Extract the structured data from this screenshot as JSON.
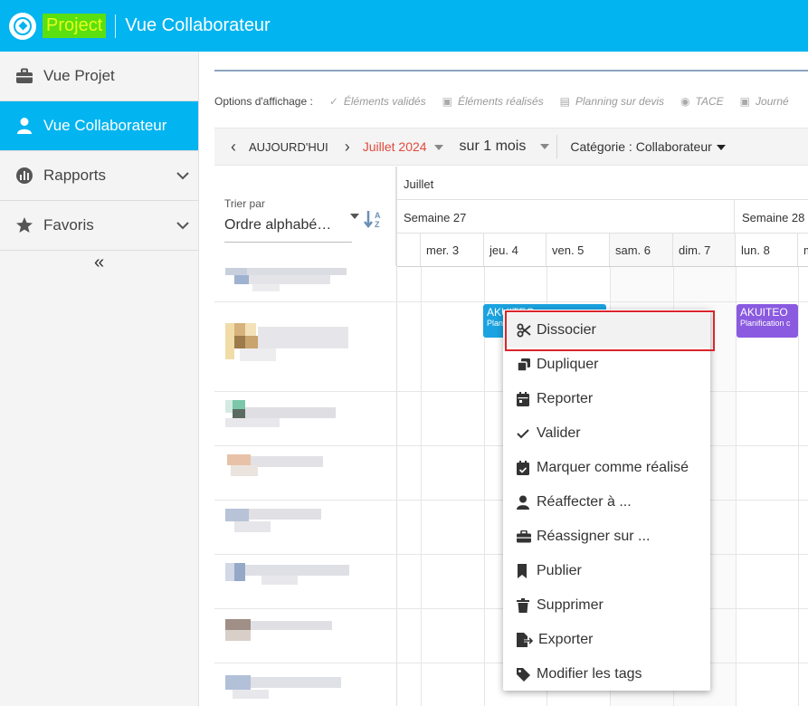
{
  "app": {
    "name": "Project",
    "view_title": "Vue Collaborateur"
  },
  "sidebar": {
    "items": [
      {
        "label": "Vue Projet",
        "icon": "briefcase-icon",
        "active": false
      },
      {
        "label": "Vue Collaborateur",
        "icon": "user-icon",
        "active": true
      },
      {
        "label": "Rapports",
        "icon": "chart-icon",
        "active": false
      },
      {
        "label": "Favoris",
        "icon": "star-icon",
        "active": false
      }
    ],
    "collapse_label": "«"
  },
  "options": {
    "label": "Options d'affichage :",
    "items": [
      "Éléments validés",
      "Éléments réalisés",
      "Planning sur devis",
      "TACE",
      "Journé"
    ]
  },
  "toolbar": {
    "today": "AUJOURD'HUI",
    "month": "Juillet 2024",
    "range": "sur 1 mois",
    "category": "Catégorie : Collaborateur"
  },
  "sort": {
    "label": "Trier par",
    "value": "Ordre alphabé…"
  },
  "calendar": {
    "month": "Juillet",
    "weeks": [
      "Semaine 27",
      "Semaine 28"
    ],
    "days": [
      "mer. 3",
      "jeu. 4",
      "ven. 5",
      "sam. 6",
      "dim. 7",
      "lun. 8",
      "m"
    ]
  },
  "events": [
    {
      "title": "AKUITEO",
      "subtitle": "Plani",
      "color": "#1aa3e0"
    },
    {
      "title": "AKUITEO",
      "subtitle": "Planification c",
      "color": "#8a5ae0"
    }
  ],
  "context_menu": {
    "items": [
      {
        "label": "Dissocier",
        "icon": "scissors-icon"
      },
      {
        "label": "Dupliquer",
        "icon": "copy-icon"
      },
      {
        "label": "Reporter",
        "icon": "calendar-icon"
      },
      {
        "label": "Valider",
        "icon": "check-icon"
      },
      {
        "label": "Marquer comme réalisé",
        "icon": "calendar-check-icon"
      },
      {
        "label": "Réaffecter à ...",
        "icon": "user-icon"
      },
      {
        "label": "Réassigner sur ...",
        "icon": "briefcase-icon"
      },
      {
        "label": "Publier",
        "icon": "bookmark-icon"
      },
      {
        "label": "Supprimer",
        "icon": "trash-icon"
      },
      {
        "label": "Exporter",
        "icon": "file-export-icon"
      },
      {
        "label": "Modifier les tags",
        "icon": "tag-icon"
      }
    ]
  },
  "colors": {
    "brand": "#02b4f0",
    "accent_month": "#e04a3c",
    "highlight": "#d9262c"
  }
}
